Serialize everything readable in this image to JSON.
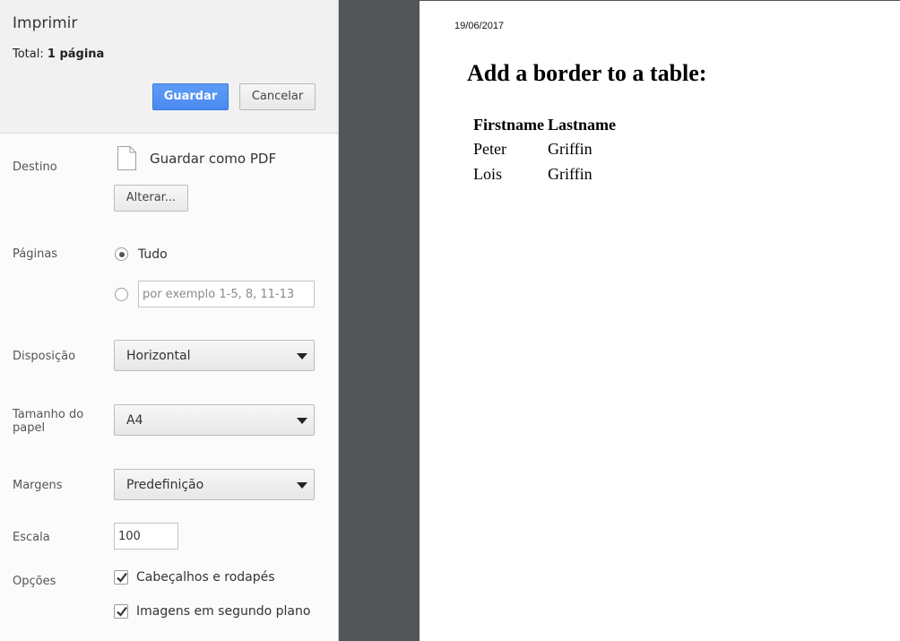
{
  "dialog": {
    "title": "Imprimir",
    "total_prefix": "Total:",
    "total_value": "1 página",
    "save_label": "Guardar",
    "cancel_label": "Cancelar"
  },
  "destination": {
    "label": "Destino",
    "name": "Guardar como PDF",
    "change_label": "Alterar...",
    "icon": "pdf-file-icon"
  },
  "pages": {
    "label": "Páginas",
    "all_label": "Tudo",
    "custom_placeholder": "por exemplo 1-5, 8, 11-13",
    "selected": "all"
  },
  "layout": {
    "label": "Disposição",
    "value": "Horizontal"
  },
  "paper_size": {
    "label": "Tamanho do papel",
    "value": "A4"
  },
  "margins": {
    "label": "Margens",
    "value": "Predefinição"
  },
  "scale": {
    "label": "Escala",
    "value": "100"
  },
  "options": {
    "label": "Opções",
    "items": [
      {
        "label": "Cabeçalhos e rodapés",
        "checked": true
      },
      {
        "label": "Imagens em segundo plano",
        "checked": true
      }
    ]
  },
  "preview": {
    "date": "19/06/2017",
    "heading": "Add a border to a table:",
    "table": {
      "headers": [
        "Firstname",
        "Lastname"
      ],
      "rows": [
        [
          "Peter",
          "Griffin"
        ],
        [
          "Lois",
          "Griffin"
        ]
      ]
    }
  },
  "colors": {
    "primary_button": "#4a8af0",
    "preview_background": "#525659"
  }
}
